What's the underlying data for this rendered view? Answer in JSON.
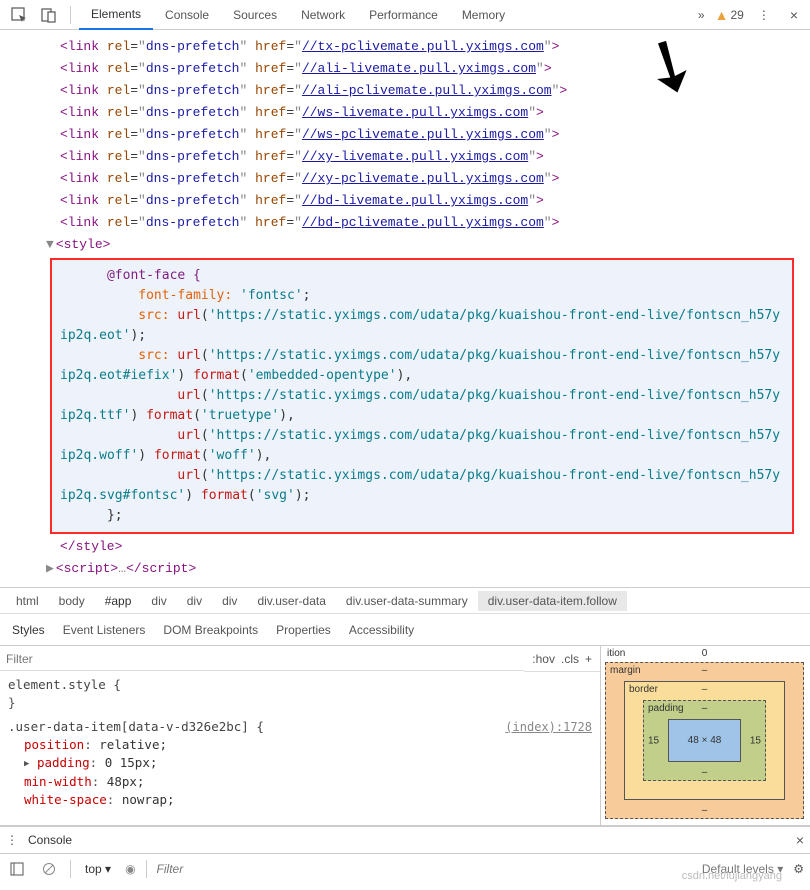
{
  "toolbar": {
    "tabs": [
      "Elements",
      "Console",
      "Sources",
      "Network",
      "Performance",
      "Memory"
    ],
    "more_glyph": "»",
    "warning_count": "29",
    "kebab": "⋮",
    "close": "×"
  },
  "links": [
    {
      "tag": "link",
      "rel": "dns-prefetch",
      "href": "//tx-pclivemate.pull.yximgs.com"
    },
    {
      "tag": "link",
      "rel": "dns-prefetch",
      "href": "//ali-livemate.pull.yximgs.com"
    },
    {
      "tag": "link",
      "rel": "dns-prefetch",
      "href": "//ali-pclivemate.pull.yximgs.com"
    },
    {
      "tag": "link",
      "rel": "dns-prefetch",
      "href": "//ws-livemate.pull.yximgs.com"
    },
    {
      "tag": "link",
      "rel": "dns-prefetch",
      "href": "//ws-pclivemate.pull.yximgs.com"
    },
    {
      "tag": "link",
      "rel": "dns-prefetch",
      "href": "//xy-livemate.pull.yximgs.com"
    },
    {
      "tag": "link",
      "rel": "dns-prefetch",
      "href": "//xy-pclivemate.pull.yximgs.com"
    },
    {
      "tag": "link",
      "rel": "dns-prefetch",
      "href": "//bd-livemate.pull.yximgs.com"
    },
    {
      "tag": "link",
      "rel": "dns-prefetch",
      "href": "//bd-pclivemate.pull.yximgs.com"
    }
  ],
  "style_open": "<style>",
  "style_close": "</style>",
  "fontface": {
    "at": "@font-face {",
    "family_key": "font-family:",
    "family_val": "'fontsc'",
    "src_key": "src:",
    "url_fn": "url",
    "format_fn": "format",
    "u1": "'https://static.yximgs.com/udata/pkg/kuaishou-front-end-live/fontscn_h57yip2q.eot'",
    "u2": "'https://static.yximgs.com/udata/pkg/kuaishou-front-end-live/fontscn_h57yip2q.eot#iefix'",
    "f2": "'embedded-opentype'",
    "u3": "'https://static.yximgs.com/udata/pkg/kuaishou-front-end-live/fontscn_h57yip2q.ttf'",
    "f3": "'truetype'",
    "u4": "'https://static.yximgs.com/udata/pkg/kuaishou-front-end-live/fontscn_h57yip2q.woff'",
    "f4": "'woff'",
    "u5": "'https://static.yximgs.com/udata/pkg/kuaishou-front-end-live/fontscn_h57yip2q.svg#fontsc'",
    "f5": "'svg'",
    "close": "};"
  },
  "script_collapsed": {
    "open": "<script>",
    "dots": "…",
    "close": "</script>"
  },
  "breadcrumbs": [
    "html",
    "body",
    "#app",
    "div",
    "div",
    "div",
    "div.user-data",
    "div.user-data-summary",
    "div.user-data-item.follow"
  ],
  "styles_pane": {
    "tabs": [
      "Styles",
      "Event Listeners",
      "DOM Breakpoints",
      "Properties",
      "Accessibility"
    ],
    "filter_placeholder": "Filter",
    "hov": ":hov",
    "cls": ".cls",
    "plus": "+",
    "element_style_label": "element.style {",
    "element_style_close": "}",
    "rule2_selector": ".user-data-item[data-v-d326e2bc] {",
    "rule2_source": "(index):1728",
    "decls": [
      {
        "name": "position",
        "value": "relative;"
      },
      {
        "name": "padding",
        "value": "0 15px;",
        "expandable": true
      },
      {
        "name": "min-width",
        "value": "48px;"
      },
      {
        "name": "white-space",
        "value": "nowrap;"
      }
    ]
  },
  "box_model": {
    "position_label": "ition",
    "position_top": "0",
    "margin_label": "margin",
    "margin_val": "–",
    "border_label": "border",
    "border_val": "–",
    "padding_label": "padding",
    "padding_top": "–",
    "padding_left": "15",
    "padding_right": "15",
    "padding_bottom": "–",
    "content": "48 × 48"
  },
  "drawer": {
    "title": "Console",
    "close": "×"
  },
  "console_bar": {
    "context": "top",
    "dropdown_glyph": "▾",
    "filter_placeholder": "Filter",
    "levels": "Default levels",
    "gear": "⚙"
  },
  "watermark": "csdn.net/lujiangyang"
}
